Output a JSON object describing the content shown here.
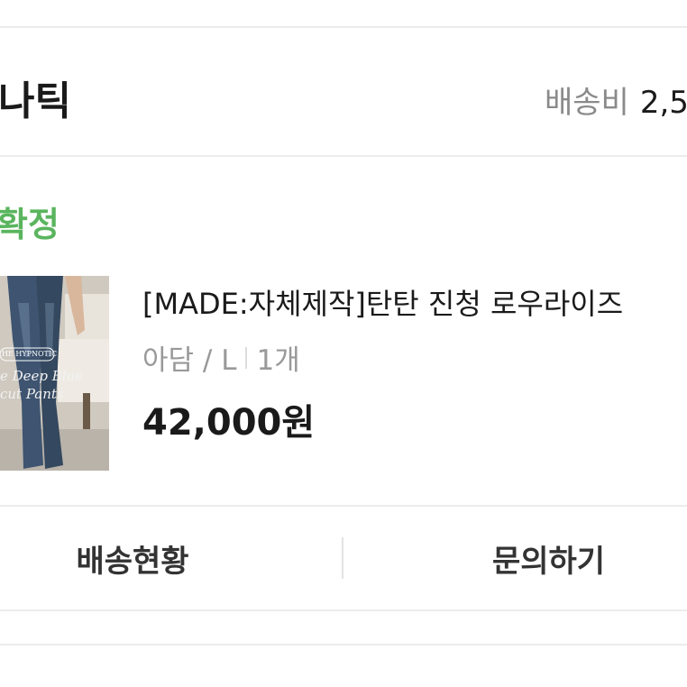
{
  "store": {
    "name": "나틱",
    "shipping_label": "배송비",
    "shipping_value": "2,5"
  },
  "order": {
    "status": "확정"
  },
  "product": {
    "title": "[MADE:자체제작]탄탄 진청 로우라이즈",
    "option": "아담 / L",
    "quantity": "1개",
    "price": "42,000원",
    "image_text_1": "HE HYPNOTIC",
    "image_text_2": "e Deep Blue",
    "image_text_3": "cut Pants"
  },
  "actions": {
    "shipping_status": "배송현황",
    "inquiry": "문의하기"
  },
  "colors": {
    "status_green": "#5ab55e",
    "divider": "#ececec",
    "text_primary": "#1a1a1a",
    "text_secondary": "#999999"
  }
}
